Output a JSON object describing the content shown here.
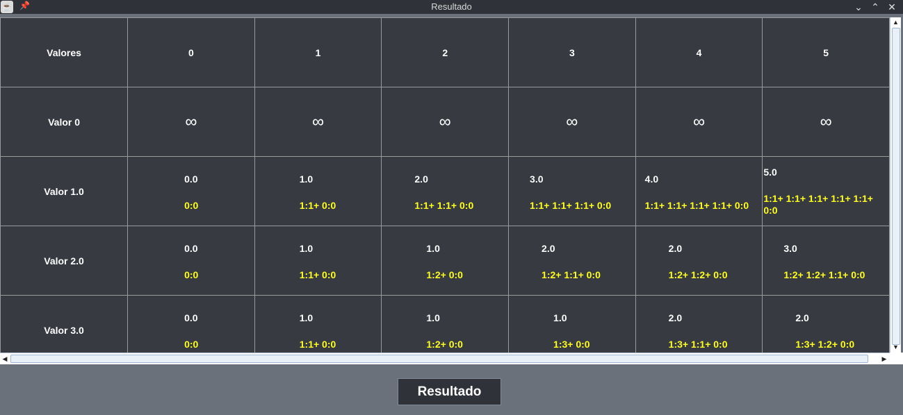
{
  "window": {
    "title": "Resultado",
    "minimize_glyph": "⌄",
    "maximize_glyph": "⌃",
    "close_glyph": "✕",
    "pin_glyph": "📌"
  },
  "table": {
    "corner_header": "Valores",
    "column_headers": [
      "0",
      "1",
      "2",
      "3",
      "4",
      "5"
    ],
    "rows": [
      {
        "label": "Valor 0",
        "cells": [
          {
            "value": "∞"
          },
          {
            "value": "∞"
          },
          {
            "value": "∞"
          },
          {
            "value": "∞"
          },
          {
            "value": "∞"
          },
          {
            "value": "∞"
          }
        ]
      },
      {
        "label": "Valor 1.0",
        "cells": [
          {
            "value": "0.0",
            "expr": "0:0"
          },
          {
            "value": "1.0",
            "expr": "1:1+ 0:0"
          },
          {
            "value": "2.0",
            "expr": "1:1+ 1:1+ 0:0"
          },
          {
            "value": "3.0",
            "expr": "1:1+ 1:1+ 1:1+ 0:0"
          },
          {
            "value": "4.0",
            "expr": "1:1+ 1:1+ 1:1+ 1:1+ 0:0"
          },
          {
            "value": "5.0",
            "expr": "1:1+ 1:1+ 1:1+ 1:1+ 1:1+ 0:0"
          }
        ]
      },
      {
        "label": "Valor 2.0",
        "cells": [
          {
            "value": "0.0",
            "expr": "0:0"
          },
          {
            "value": "1.0",
            "expr": "1:1+ 0:0"
          },
          {
            "value": "1.0",
            "expr": "1:2+ 0:0"
          },
          {
            "value": "2.0",
            "expr": "1:2+ 1:1+ 0:0"
          },
          {
            "value": "2.0",
            "expr": "1:2+ 1:2+ 0:0"
          },
          {
            "value": "3.0",
            "expr": "1:2+ 1:2+ 1:1+ 0:0"
          }
        ]
      },
      {
        "label": "Valor 3.0",
        "cells": [
          {
            "value": "0.0",
            "expr": "0:0"
          },
          {
            "value": "1.0",
            "expr": "1:1+ 0:0"
          },
          {
            "value": "1.0",
            "expr": "1:2+ 0:0"
          },
          {
            "value": "1.0",
            "expr": "1:3+ 0:0"
          },
          {
            "value": "2.0",
            "expr": "1:3+ 1:1+ 0:0"
          },
          {
            "value": "2.0",
            "expr": "1:3+ 1:2+ 0:0"
          }
        ]
      }
    ]
  },
  "scrollbar": {
    "up_glyph": "▲",
    "down_glyph": "▼",
    "left_glyph": "◀",
    "right_glyph": "▶"
  },
  "actions": {
    "result_button": "Resultado"
  },
  "colors": {
    "cell_background": "#373a41",
    "expression_text": "#ffff1e",
    "value_text": "#ffffff",
    "panel_background": "#6b717b"
  }
}
